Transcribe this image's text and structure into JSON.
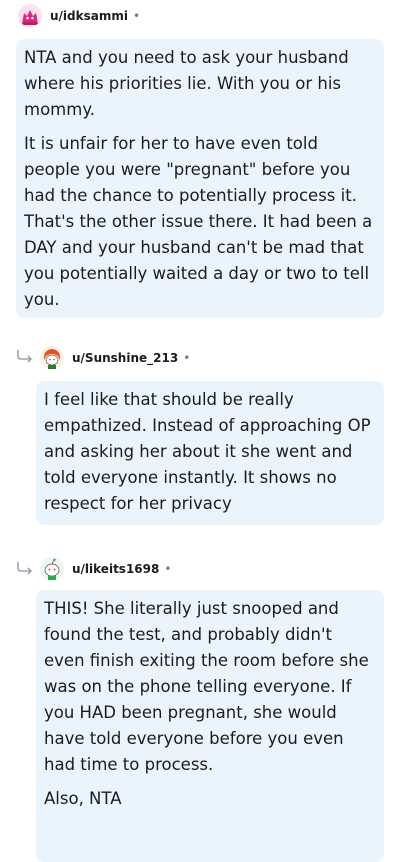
{
  "comments": [
    {
      "username": "u/idksammi",
      "separator": "•",
      "avatar_icon": "pink-avatar-icon",
      "paragraphs": [
        "NTA and you need to ask your husband where his priorities lie. With you or his mommy.",
        "It is unfair for her to have even told people you were \"pregnant\" before you had the chance to potentially process it. That's the other issue there. It had been a DAY and your husband can't be mad that you potentially waited a day or two to tell you."
      ]
    },
    {
      "username": "u/Sunshine_213",
      "separator": "•",
      "avatar_icon": "orange-hair-avatar-icon",
      "reply_icon": "reply-arrow-icon",
      "paragraphs": [
        "I feel like that should be really empathized. Instead of approaching OP and asking her about it she went and told everyone instantly. It shows no respect for her privacy"
      ]
    },
    {
      "username": "u/likeits1698",
      "separator": "•",
      "avatar_icon": "green-snoo-avatar-icon",
      "reply_icon": "reply-arrow-icon",
      "paragraphs": [
        "THIS! She literally just snooped and found the test, and probably didn't even finish exiting the room before she was on the phone telling everyone. If you HAD been pregnant, she would have told everyone before you even had time to process.",
        "Also, NTA"
      ]
    }
  ],
  "colors": {
    "bubble_bg": "#eaf4fc",
    "text": "#1c1c1c",
    "meta": "#7c7c7c"
  }
}
